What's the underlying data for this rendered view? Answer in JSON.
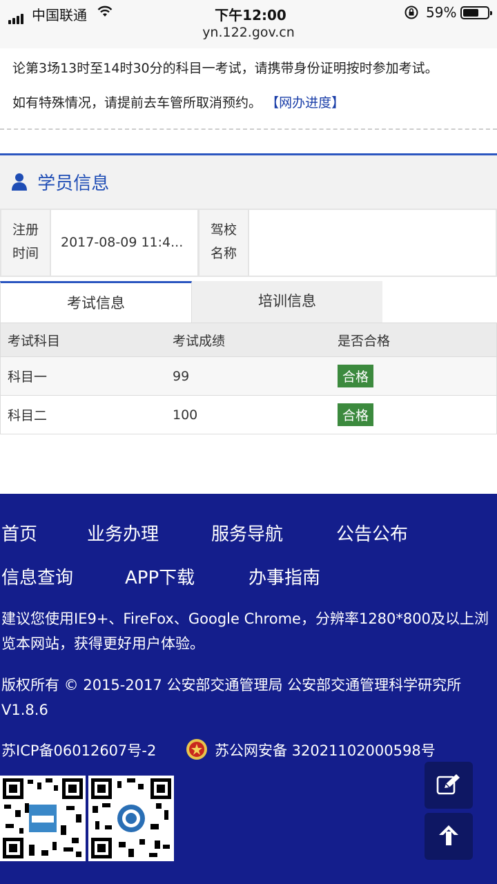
{
  "status_bar": {
    "carrier": "中国联通",
    "time": "下午12:00",
    "battery_percent": "59%",
    "url": "yn.122.gov.cn",
    "icons": [
      "signal-icon",
      "wifi-icon",
      "orientation-lock-icon",
      "battery-icon"
    ]
  },
  "notice": {
    "line1": "论第3场13时至14时30分的科目一考试，请携带身份证明按时参加考试。",
    "line2_text": "如有特殊情况，请提前去车管所取消预约。",
    "line2_link": "【网办进度】"
  },
  "student_info": {
    "title": "学员信息",
    "icon": "user-icon",
    "fields": [
      {
        "label": "注册时间",
        "label_l1": "注册",
        "label_l2": "时间",
        "value": "2017-08-09 11:4..."
      },
      {
        "label": "驾校名称",
        "label_l1": "驾校",
        "label_l2": "名称",
        "value": ""
      }
    ]
  },
  "tabs": [
    {
      "label": "考试信息",
      "active": true
    },
    {
      "label": "培训信息",
      "active": false
    }
  ],
  "exam_table": {
    "columns": [
      "考试科目",
      "考试成绩",
      "是否合格"
    ],
    "rows": [
      {
        "subject": "科目一",
        "score": "99",
        "result": "合格"
      },
      {
        "subject": "科目二",
        "score": "100",
        "result": "合格"
      }
    ]
  },
  "footer": {
    "nav_row1": [
      "首页",
      "业务办理",
      "服务导航",
      "公告公布"
    ],
    "nav_row2": [
      "信息查询",
      "APP下载",
      "办事指南"
    ],
    "browser_note": "建议您使用IE9+、FireFox、Google Chrome，分辨率1280*800及以上浏览本网站，获得更好用户体验。",
    "copyright": "版权所有 © 2015-2017 公安部交通管理局 公安部交通管理科学研究所 V1.8.6",
    "icp": "苏ICP备06012607号-2",
    "police_record": "苏公网安备 32021102000598号",
    "qr_codes": [
      "app-qr-code",
      "wechat-qr-code"
    ]
  },
  "floating_buttons": [
    "edit-icon",
    "back-to-top-icon"
  ],
  "colors": {
    "accent_blue": "#2b56c0",
    "footer_bg": "#141e8c",
    "pass_green": "#3c8a3e",
    "link_blue": "#1a3ea8"
  }
}
